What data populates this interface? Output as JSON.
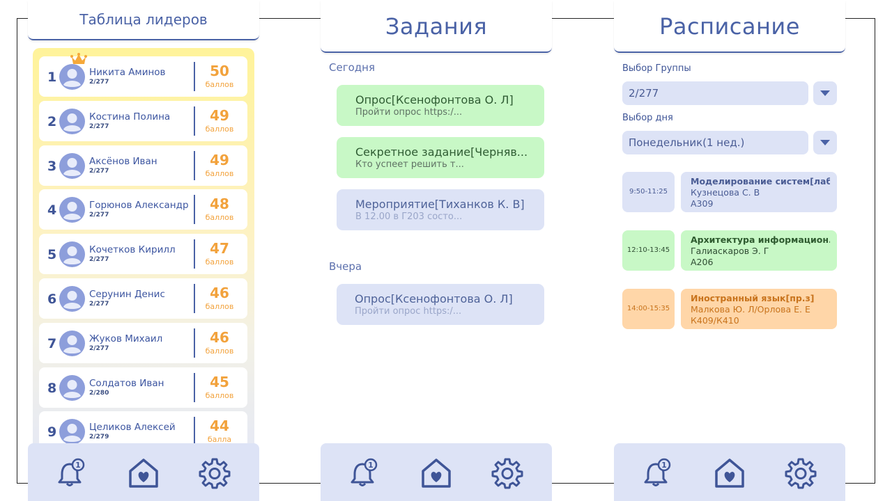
{
  "leaderboard": {
    "title": "Таблица лидеров",
    "rows": [
      {
        "rank": "1",
        "name": "Никита Аминов",
        "group": "2/277",
        "score": "50",
        "unit": "баллов"
      },
      {
        "rank": "2",
        "name": "Костина Полина",
        "group": "2/277",
        "score": "49",
        "unit": "баллов"
      },
      {
        "rank": "3",
        "name": "Аксёнов Иван",
        "group": "2/277",
        "score": "49",
        "unit": "баллов"
      },
      {
        "rank": "4",
        "name": "Горюнов Александр",
        "group": "2/277",
        "score": "48",
        "unit": "баллов"
      },
      {
        "rank": "5",
        "name": "Кочетков Кирилл",
        "group": "2/277",
        "score": "47",
        "unit": "баллов"
      },
      {
        "rank": "6",
        "name": "Серунин Денис",
        "group": "2/277",
        "score": "46",
        "unit": "баллов"
      },
      {
        "rank": "7",
        "name": "Жуков Михаил",
        "group": "2/277",
        "score": "46",
        "unit": "баллов"
      },
      {
        "rank": "8",
        "name": "Солдатов Иван",
        "group": "2/280",
        "score": "45",
        "unit": "баллов"
      },
      {
        "rank": "9",
        "name": "Целиков Алексей",
        "group": "2/279",
        "score": "44",
        "unit": "балла"
      }
    ]
  },
  "tasks": {
    "title": "Задания",
    "today_label": "Сегодня",
    "today": [
      {
        "title": "Опрос[Ксенофонтова О. Л]",
        "subtitle": "Пройти опрос https:/...",
        "state": "new"
      },
      {
        "title": "Секретное задание[Черняв...",
        "subtitle": " Кто успеет решить т...",
        "state": "new"
      },
      {
        "title": "Мероприятие[Тиханков К. В]",
        "subtitle": " В 12.00 в Г203 состо...",
        "state": "read"
      }
    ],
    "yesterday_label": "Вчера",
    "yesterday": [
      {
        "title": "Опрос[Ксенофонтова О. Л]",
        "subtitle": "Пройти опрос https:/...",
        "state": "read"
      }
    ]
  },
  "schedule": {
    "title": "Расписание",
    "group_label": "Выбор Группы",
    "group_value": "2/277",
    "day_label": "Выбор дня",
    "day_value": "Понедельник(1 нед.)",
    "lessons": [
      {
        "time": "9:50-11:25",
        "title": "Моделирование систем[лаб]",
        "teacher": "Кузнецова С. В",
        "room": "А309",
        "color": "#dde3f6",
        "title_color": "#4a5c94"
      },
      {
        "time": "12:10-13:45",
        "title": "Архитектура информацион...",
        "teacher": "Галиаскаров Э. Г",
        "room": "А206",
        "color": "#c8f8c6",
        "title_color": "#2e5a2f"
      },
      {
        "time": "14:00-15:35",
        "title": "Иностранный язык[пр.з]",
        "teacher": "Малкова Ю. Л/Орлова Е. Е",
        "room": "К409/К410",
        "color": "#ffd6a8",
        "title_color": "#c8731c"
      }
    ]
  },
  "nav": {
    "notification_badge": "1",
    "icons": [
      "bell-icon",
      "home-heart-icon",
      "gear-icon"
    ]
  },
  "colors": {
    "primary": "#4a62a6",
    "score": "#f2a23c",
    "green": "#c8f8c6",
    "blue": "#dde3f6",
    "orange": "#ffd6a8"
  }
}
